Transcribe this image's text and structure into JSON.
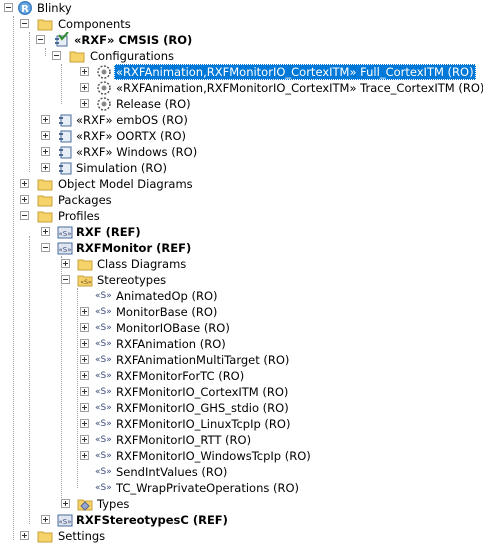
{
  "tree": {
    "root": "Blinky",
    "components": "Components",
    "rxf_cmsis": "«RXF» CMSIS (RO)",
    "configurations": "Configurations",
    "config_full": "«RXFAnimation,RXFMonitorIO_CortexITM» Full_CortexITM (RO)",
    "config_trace": "«RXFAnimation,RXFMonitorIO_CortexITM» Trace_CortexITM (RO)",
    "config_release": "Release (RO)",
    "rxf_embos": "«RXF» embOS (RO)",
    "rxf_oortx": "«RXF» OORTX (RO)",
    "rxf_windows": "«RXF» Windows (RO)",
    "simulation": "Simulation (RO)",
    "omd": "Object Model Diagrams",
    "packages": "Packages",
    "profiles": "Profiles",
    "rxf_ref": "RXF (REF)",
    "rxfmonitor_ref": "RXFMonitor (REF)",
    "class_diagrams": "Class Diagrams",
    "stereotypes": "Stereotypes",
    "stereotype_items": [
      "AnimatedOp (RO)",
      "MonitorBase (RO)",
      "MonitorIOBase (RO)",
      "RXFAnimation (RO)",
      "RXFAnimationMultiTarget (RO)",
      "RXFMonitorForTC (RO)",
      "RXFMonitorIO_CortexITM (RO)",
      "RXFMonitorIO_GHS_stdio (RO)",
      "RXFMonitorIO_LinuxTcpIp (RO)",
      "RXFMonitorIO_RTT (RO)",
      "RXFMonitorIO_WindowsTcpIp (RO)",
      "SendIntValues (RO)",
      "TC_WrapPrivateOperations (RO)"
    ],
    "types": "Types",
    "rxfstereotypesc_ref": "RXFStereotypesC (REF)",
    "settings": "Settings"
  },
  "stereotype_glyph": "«S»",
  "selection_color": "#0078d7",
  "icon_names": [
    "project-icon",
    "folder-icon",
    "component-icon",
    "configuration-icon",
    "stereotype-icon",
    "package-icon"
  ]
}
